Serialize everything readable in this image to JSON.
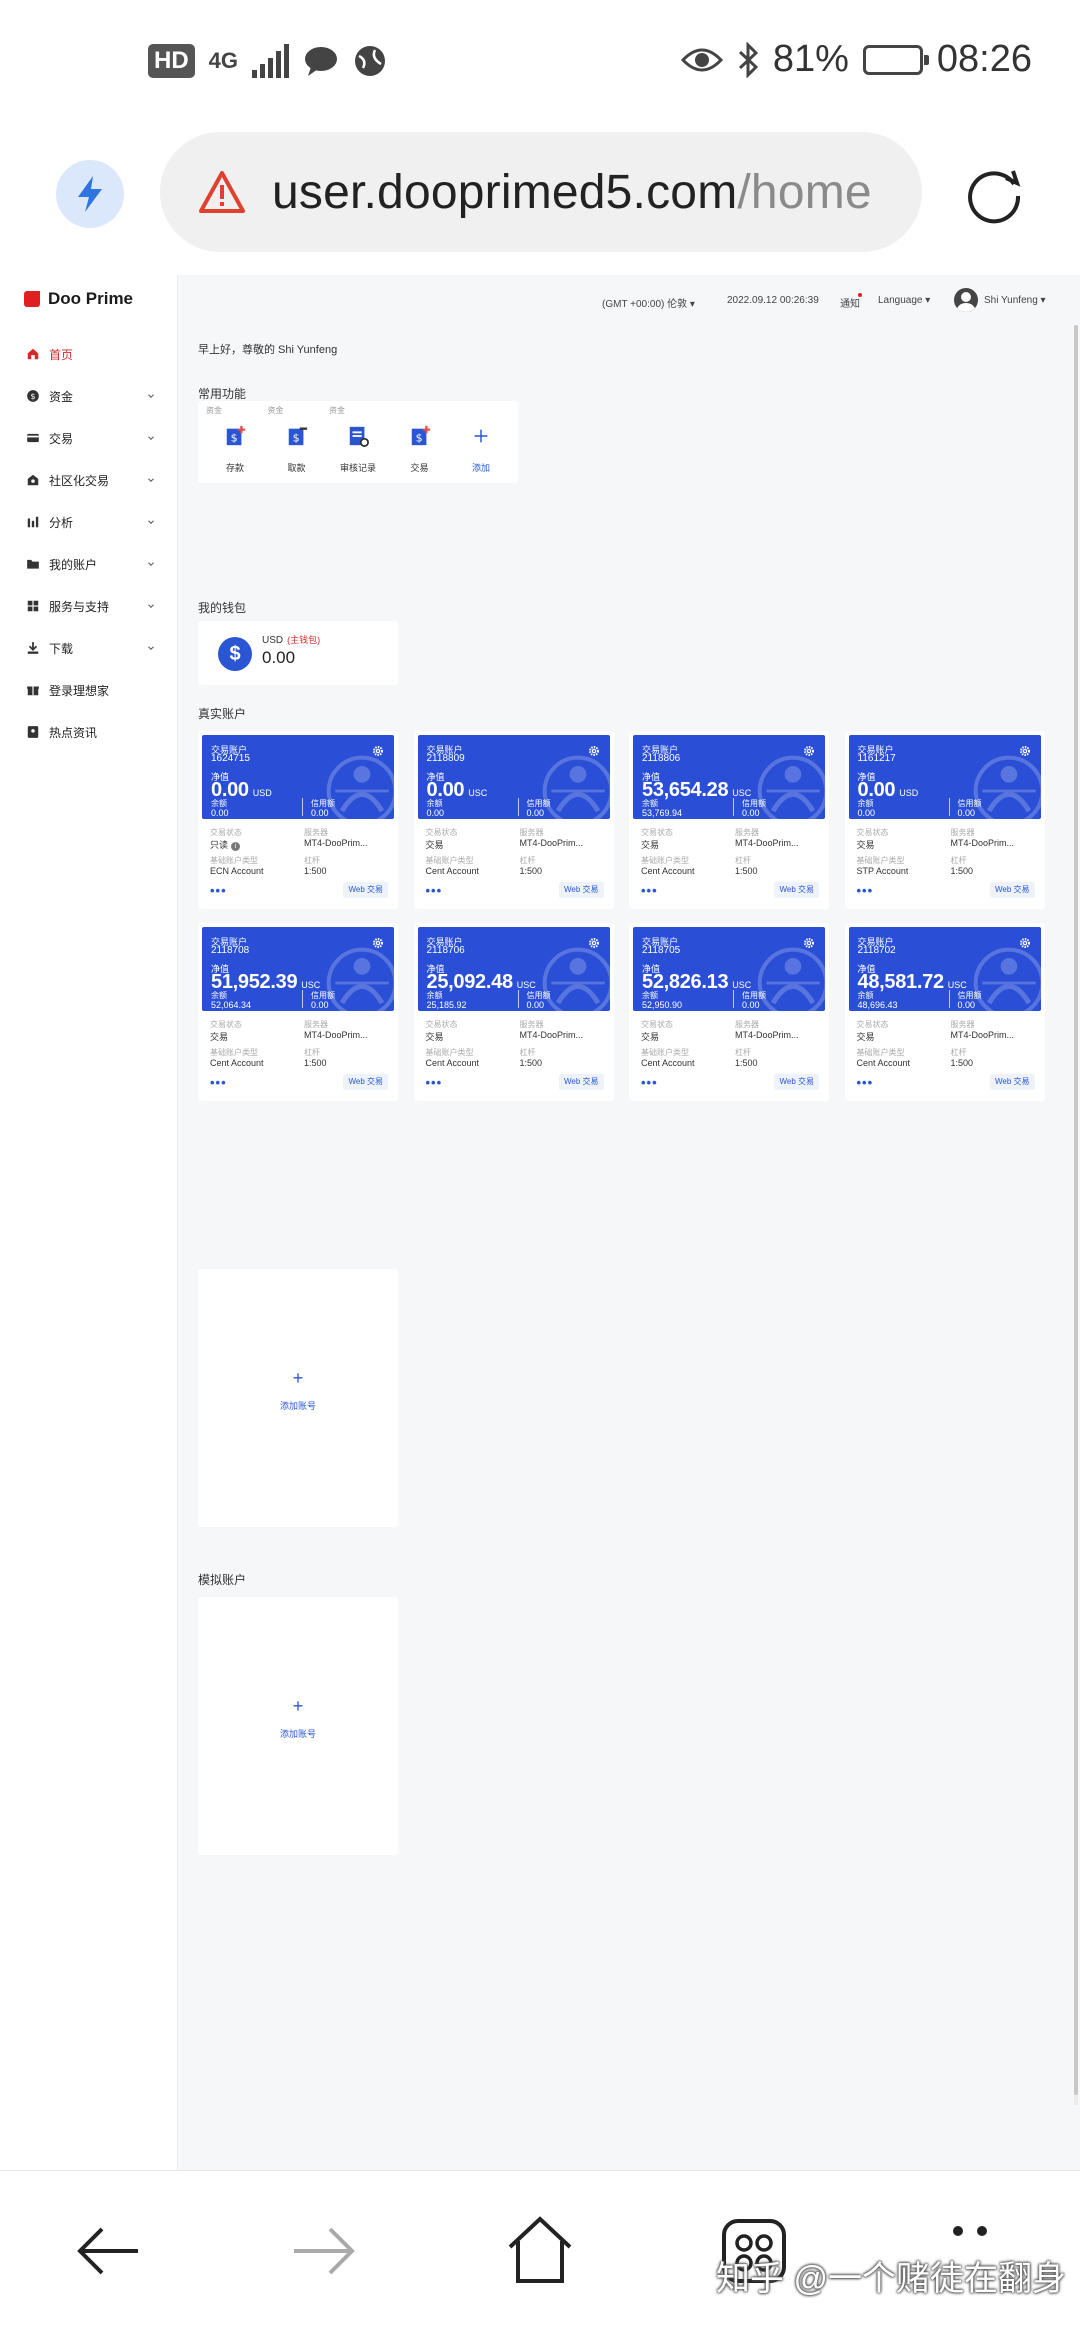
{
  "status_bar": {
    "hd": "HD",
    "network": "4G",
    "battery_percent": "81%",
    "battery_level": 0.81,
    "time": "08:26"
  },
  "browser": {
    "url_domain": "user.dooprimed5.com",
    "url_path": "/home"
  },
  "logo": {
    "text": "Doo Prime"
  },
  "nav": [
    {
      "label": "首页",
      "icon": "home-icon",
      "active": true,
      "has_chevron": false
    },
    {
      "label": "资金",
      "icon": "dollar-icon",
      "active": false,
      "has_chevron": true
    },
    {
      "label": "交易",
      "icon": "card-icon",
      "active": false,
      "has_chevron": true
    },
    {
      "label": "社区化交易",
      "icon": "community-icon",
      "active": false,
      "has_chevron": true
    },
    {
      "label": "分析",
      "icon": "bar-chart-icon",
      "active": false,
      "has_chevron": true
    },
    {
      "label": "我的账户",
      "icon": "folder-icon",
      "active": false,
      "has_chevron": true
    },
    {
      "label": "服务与支持",
      "icon": "grid-icon",
      "active": false,
      "has_chevron": true
    },
    {
      "label": "下载",
      "icon": "download-icon",
      "active": false,
      "has_chevron": true
    },
    {
      "label": "登录理想家",
      "icon": "gift-icon",
      "active": false,
      "has_chevron": false
    },
    {
      "label": "热点资讯",
      "icon": "news-icon",
      "active": false,
      "has_chevron": false
    }
  ],
  "topbar": {
    "timezone": "(GMT +00:00) 伦敦",
    "datetime": "2022.09.12 00:26:39",
    "notify": "通知",
    "language": "Language",
    "user": "Shi Yunfeng"
  },
  "greeting": "早上好，尊敬的 Shi Yunfeng",
  "quick_title": "常用功能",
  "quick_actions": [
    {
      "tag": "资金",
      "label": "存款",
      "icon": "deposit-icon"
    },
    {
      "tag": "资金",
      "label": "取款",
      "icon": "withdraw-icon"
    },
    {
      "tag": "资金",
      "label": "审核记录",
      "icon": "review-record-icon"
    },
    {
      "tag": "",
      "label": "交易",
      "icon": "trade-icon"
    },
    {
      "tag": "",
      "label": "添加",
      "icon": "plus-icon"
    }
  ],
  "wallet_title": "我的钱包",
  "wallet": {
    "currency": "USD",
    "tag": "(主钱包)",
    "value": "0.00"
  },
  "real_title": "真实账户",
  "labels": {
    "account": "交易账户",
    "equity": "净值",
    "balance": "余额",
    "credit": "信用额",
    "status": "交易状态",
    "server": "服务器",
    "base_type": "基础账户类型",
    "leverage": "杠杆",
    "web": "Web 交易",
    "more": "•••",
    "add_account": "添加账号"
  },
  "accounts": [
    {
      "number": "1624715",
      "equity": "0.00",
      "currency": "USD",
      "balance": "0.00",
      "credit": "0.00",
      "status": "只读",
      "status_info": true,
      "server": "MT4-DooPrim...",
      "type": "ECN Account",
      "leverage": "1:500"
    },
    {
      "number": "2118809",
      "equity": "0.00",
      "currency": "USC",
      "balance": "0.00",
      "credit": "0.00",
      "status": "交易",
      "status_info": false,
      "server": "MT4-DooPrim...",
      "type": "Cent Account",
      "leverage": "1:500"
    },
    {
      "number": "2118806",
      "equity": "53,654.28",
      "currency": "USC",
      "balance": "53,769.94",
      "credit": "0.00",
      "status": "交易",
      "status_info": false,
      "server": "MT4-DooPrim...",
      "type": "Cent Account",
      "leverage": "1:500"
    },
    {
      "number": "1161217",
      "equity": "0.00",
      "currency": "USD",
      "balance": "0.00",
      "credit": "0.00",
      "status": "交易",
      "status_info": false,
      "server": "MT4-DooPrim...",
      "type": "STP Account",
      "leverage": "1:500"
    },
    {
      "number": "2118708",
      "equity": "51,952.39",
      "currency": "USC",
      "balance": "52,064.34",
      "credit": "0.00",
      "status": "交易",
      "status_info": false,
      "server": "MT4-DooPrim...",
      "type": "Cent Account",
      "leverage": "1:500"
    },
    {
      "number": "2118706",
      "equity": "25,092.48",
      "currency": "USC",
      "balance": "25,185.92",
      "credit": "0.00",
      "status": "交易",
      "status_info": false,
      "server": "MT4-DooPrim...",
      "type": "Cent Account",
      "leverage": "1:500"
    },
    {
      "number": "2118705",
      "equity": "52,826.13",
      "currency": "USC",
      "balance": "52,950.90",
      "credit": "0.00",
      "status": "交易",
      "status_info": false,
      "server": "MT4-DooPrim...",
      "type": "Cent Account",
      "leverage": "1:500"
    },
    {
      "number": "2118702",
      "equity": "48,581.72",
      "currency": "USC",
      "balance": "48,696.43",
      "credit": "0.00",
      "status": "交易",
      "status_info": false,
      "server": "MT4-DooPrim...",
      "type": "Cent Account",
      "leverage": "1:500"
    }
  ],
  "demo_title": "模拟账户",
  "colors": {
    "accent": "#2a4fd6",
    "active_nav": "#d62a2a"
  },
  "watermark": "知乎 @一个赌徒在翻身"
}
